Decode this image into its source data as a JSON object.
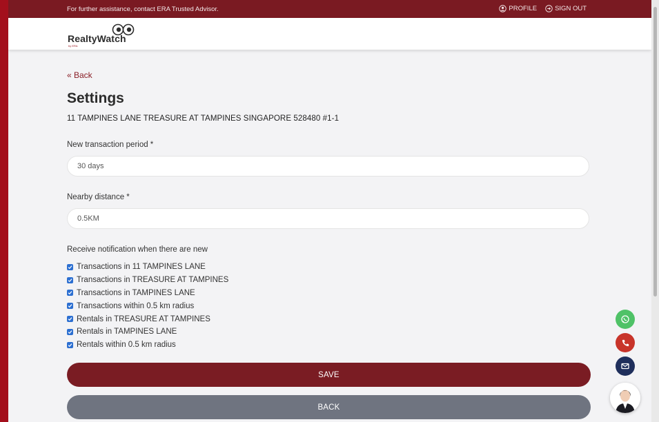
{
  "topbar": {
    "assistance_text": "For further assistance, contact ERA Trusted Advisor.",
    "profile_label": "PROFILE",
    "signout_label": "SIGN OUT"
  },
  "header": {
    "logo_text": "RealtyWatch",
    "logo_sub": "by ERA"
  },
  "main": {
    "back_link": "« Back",
    "title": "Settings",
    "address": "11 TAMPINES LANE TREASURE AT TAMPINES SINGAPORE 528480 #1-1",
    "transaction_period": {
      "label": "New transaction period *",
      "value": "30 days"
    },
    "nearby_distance": {
      "label": "Nearby distance *",
      "value": "0.5KM"
    },
    "notification_heading": "Receive notification when there are new",
    "notifications": [
      {
        "label": "Transactions in 11 TAMPINES LANE",
        "checked": true
      },
      {
        "label": "Transactions in TREASURE AT TAMPINES",
        "checked": true
      },
      {
        "label": "Transactions in TAMPINES LANE",
        "checked": true
      },
      {
        "label": "Transactions within 0.5 km radius",
        "checked": true
      },
      {
        "label": "Rentals in TREASURE AT TAMPINES",
        "checked": true
      },
      {
        "label": "Rentals in TAMPINES LANE",
        "checked": true
      },
      {
        "label": "Rentals within 0.5 km radius",
        "checked": true
      }
    ],
    "save_label": "SAVE",
    "back_label": "BACK"
  },
  "floating": {
    "icons": [
      "whatsapp-icon",
      "phone-icon",
      "mail-icon"
    ],
    "colors": {
      "whatsapp": "#4fc267",
      "phone": "#c8342a",
      "mail": "#1f2f5c"
    }
  },
  "colors": {
    "brand": "#7a1c23",
    "topbar": "#7a1a22",
    "back_button": "#6f7480",
    "checkbox": "#2c6fd1"
  }
}
